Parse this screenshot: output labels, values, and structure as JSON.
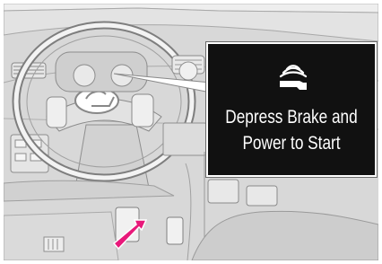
{
  "callout": {
    "line1": "Depress Brake and",
    "line2": "Power to Start",
    "icon": "key-fob-signal-icon"
  },
  "indicator": {
    "icon": "arrow-up-right-icon",
    "color": "#e8197a"
  },
  "colors": {
    "panel_background": "#111111",
    "panel_text": "#ffffff",
    "illustration_gray": "#d9d9d9"
  }
}
